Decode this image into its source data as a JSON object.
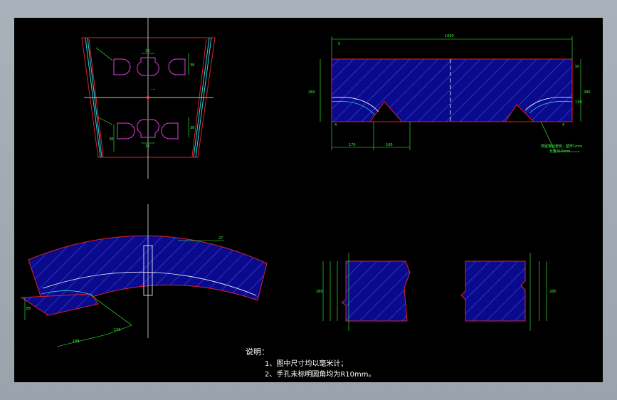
{
  "drawing": {
    "background": "#000000",
    "outline_color": "#e0202a",
    "hatch_color": "#3a3acc",
    "fill_color": "#0a0a8c",
    "dimension_color": "#39ff39",
    "centerline_color": "#ffffff",
    "hole_color": "#e040e0",
    "cyan_color": "#30d0e0"
  },
  "views": {
    "top_left": {
      "dims": [
        "38",
        "38",
        "38",
        "38",
        "38"
      ]
    },
    "top_right": {
      "dim_overall": "1000",
      "dim_left_offset": "5",
      "dim_height": "280",
      "dim_right": "280",
      "dim_bottom_left": "170",
      "dim_bottom_mid": "160",
      "dim_right_small_1": "50",
      "dim_right_small_2": "130",
      "dim_right_small_3": "4",
      "dim_left_small": "4",
      "annotation_1": "预留钢丝套管，壁厚1mm",
      "annotation_2": "长度310mm"
    },
    "bottom_left": {
      "dim_top_right": "27",
      "dim_left": "85",
      "dim_bottom_1": "188",
      "dim_bottom_2": "150"
    },
    "bottom_mid": {
      "dim_left": "280"
    },
    "bottom_right": {
      "dim_right": "280"
    }
  },
  "notes": {
    "title": "说明：",
    "line1": "1、图中尺寸均以毫米计；",
    "line2": "2、手孔未标明圆角均为R10mm。"
  }
}
